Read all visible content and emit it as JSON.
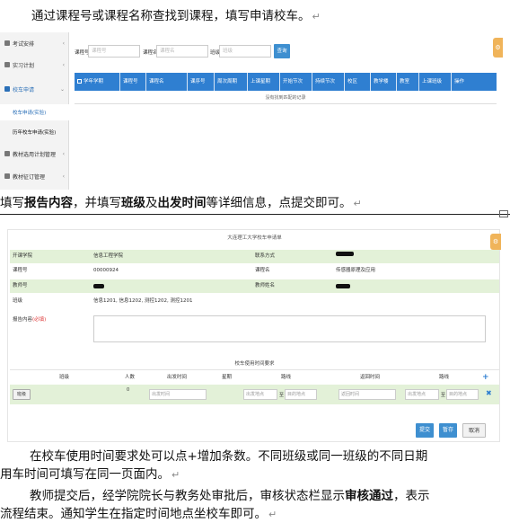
{
  "intro": "通过课程号或课程名称查找到课程，填写申请校车。",
  "shot1": {
    "sidebar": [
      {
        "label": "考试安排",
        "icon": "exam-icon"
      },
      {
        "label": "实习计划",
        "icon": "flask-icon"
      },
      {
        "label": "校车申请",
        "icon": "bus-icon"
      },
      {
        "label": "校车申请(实验)",
        "icon": ""
      },
      {
        "label": "历年校车申请(实验)",
        "icon": ""
      },
      {
        "label": "教材选用计划管理",
        "icon": "book-icon"
      },
      {
        "label": "教材征订管理",
        "icon": "book-icon"
      }
    ],
    "filters": {
      "course_no_label": "课程号",
      "course_no_placeholder": "课程号",
      "course_name_label": "课程名",
      "course_name_placeholder": "课程名",
      "class_label": "班级",
      "class_placeholder": "班级",
      "query_button": "查询"
    },
    "columns": [
      "学年学期",
      "课程号",
      "课程名",
      "课序号",
      "周次周期",
      "上课星期",
      "开始节次",
      "持续节次",
      "校区",
      "教学楼",
      "教室",
      "上课班级",
      "操作"
    ],
    "empty_text": "没有找到匹配的记录",
    "gear_glyph": "⚙"
  },
  "mid": {
    "t1": "填写",
    "b1": "报告内容",
    "t2": "，并填写",
    "b2": "班级",
    "t3": "及",
    "b3": "出发时间",
    "t4": "等详细信息，点提交即可。"
  },
  "shot2": {
    "title": "大连理工大学校车申请单",
    "fields": {
      "college_label": "开课学院",
      "college_value": "信息工程学院",
      "contact_label": "联系方式",
      "course_no_label": "课程号",
      "course_no_value": "00000924",
      "course_name_label": "课程名",
      "course_name_value": "传感器原理及应用",
      "teacher_no_label": "教师号",
      "teacher_name_label": "教师姓名",
      "class_label": "班级",
      "class_value": "信息1201, 信息1202, 测控1202, 测控1201",
      "report_label": "报告内容",
      "report_required": "(必填)"
    },
    "schedule": {
      "title": "校车使用时间要求",
      "headers": [
        "班级",
        "人数",
        "出发时间",
        "星期",
        "路线",
        "返回时间",
        "路线"
      ],
      "plus": "+",
      "row": {
        "class_button": "班级",
        "count": "0",
        "depart_placeholder": "出发时间",
        "start_placeholder": "出发地点",
        "to": "至",
        "dest_placeholder": "目的地点",
        "return_placeholder": "返回时间",
        "start2_placeholder": "出发地点",
        "dest2_placeholder": "目的地点"
      },
      "remove": "✖"
    },
    "buttons": {
      "submit": "提交",
      "save": "暂存",
      "cancel": "取消"
    },
    "gear_glyph": "⚙"
  },
  "bottom": {
    "p1_line1": "在校车使用时间要求处可以点+增加条数。不同班级或同一班级的不同日期",
    "p1_line2": "用车时间可填写在同一页面内。",
    "p2_line1a": "教师提交后，经学院院长与教务处审批后，审核状态栏显示",
    "p2_line1b": "审核通过",
    "p2_line1c": "，表示",
    "p2_line2": "流程结束。通知学生在指定时间地点坐校车即可。"
  },
  "pilcrow": "↵"
}
